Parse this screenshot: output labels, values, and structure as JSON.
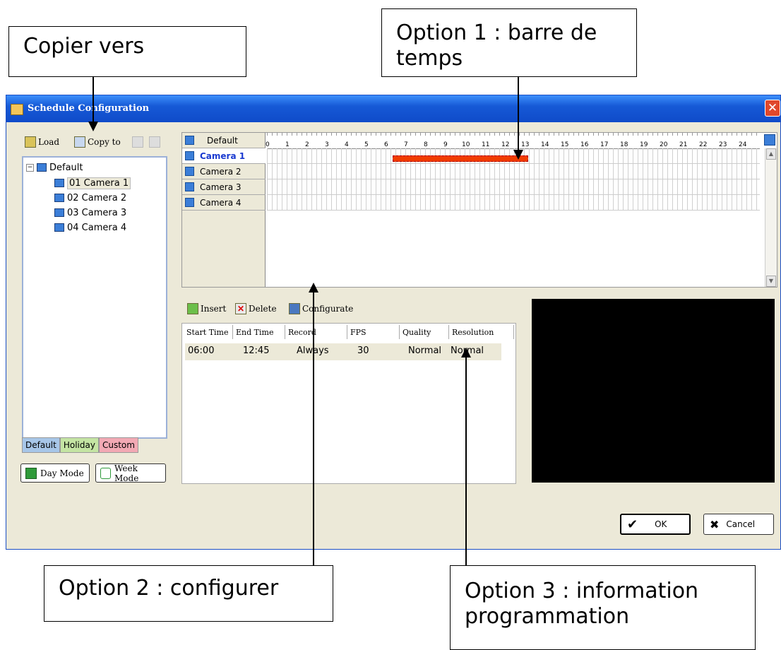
{
  "callouts": {
    "copy_to": "Copier vers",
    "option1_line1": "Option 1 : barre de",
    "option1_line2": "temps",
    "option2": "Option 2 : configurer",
    "option3_line1": "Option 3 : information",
    "option3_line2": "programmation"
  },
  "window": {
    "title": "Schedule Configuration",
    "close_glyph": "✕"
  },
  "toolbar": {
    "load": "Load",
    "copy_to": "Copy to"
  },
  "tree": {
    "root": "Default",
    "expander": "−",
    "items": [
      {
        "label": "01 Camera 1"
      },
      {
        "label": "02 Camera 2"
      },
      {
        "label": "03 Camera 3"
      },
      {
        "label": "04 Camera 4"
      }
    ]
  },
  "tabs": [
    {
      "label": "Default"
    },
    {
      "label": "Holiday"
    },
    {
      "label": "Custom"
    }
  ],
  "modes": {
    "day": "Day Mode",
    "week": "Week Mode"
  },
  "timeline": {
    "header": "Default",
    "hours": [
      "0",
      "1",
      "2",
      "3",
      "4",
      "5",
      "6",
      "7",
      "8",
      "9",
      "10",
      "11",
      "12",
      "13",
      "14",
      "15",
      "16",
      "17",
      "18",
      "19",
      "20",
      "21",
      "22",
      "23",
      "24"
    ],
    "rows": [
      {
        "label": "Camera 1"
      },
      {
        "label": "Camera 2"
      },
      {
        "label": "Camera 3"
      },
      {
        "label": "Camera 4"
      }
    ]
  },
  "actions": {
    "insert": "Insert",
    "delete": "Delete",
    "configurate": "Configurate"
  },
  "table": {
    "columns": [
      "Start Time",
      "End Time",
      "Record",
      "FPS",
      "Quality",
      "Resolution"
    ],
    "rows": [
      [
        "06:00",
        "12:45",
        "Always",
        "30",
        "Normal",
        "Normal"
      ]
    ]
  },
  "buttons": {
    "ok": "OK",
    "cancel": "Cancel"
  }
}
